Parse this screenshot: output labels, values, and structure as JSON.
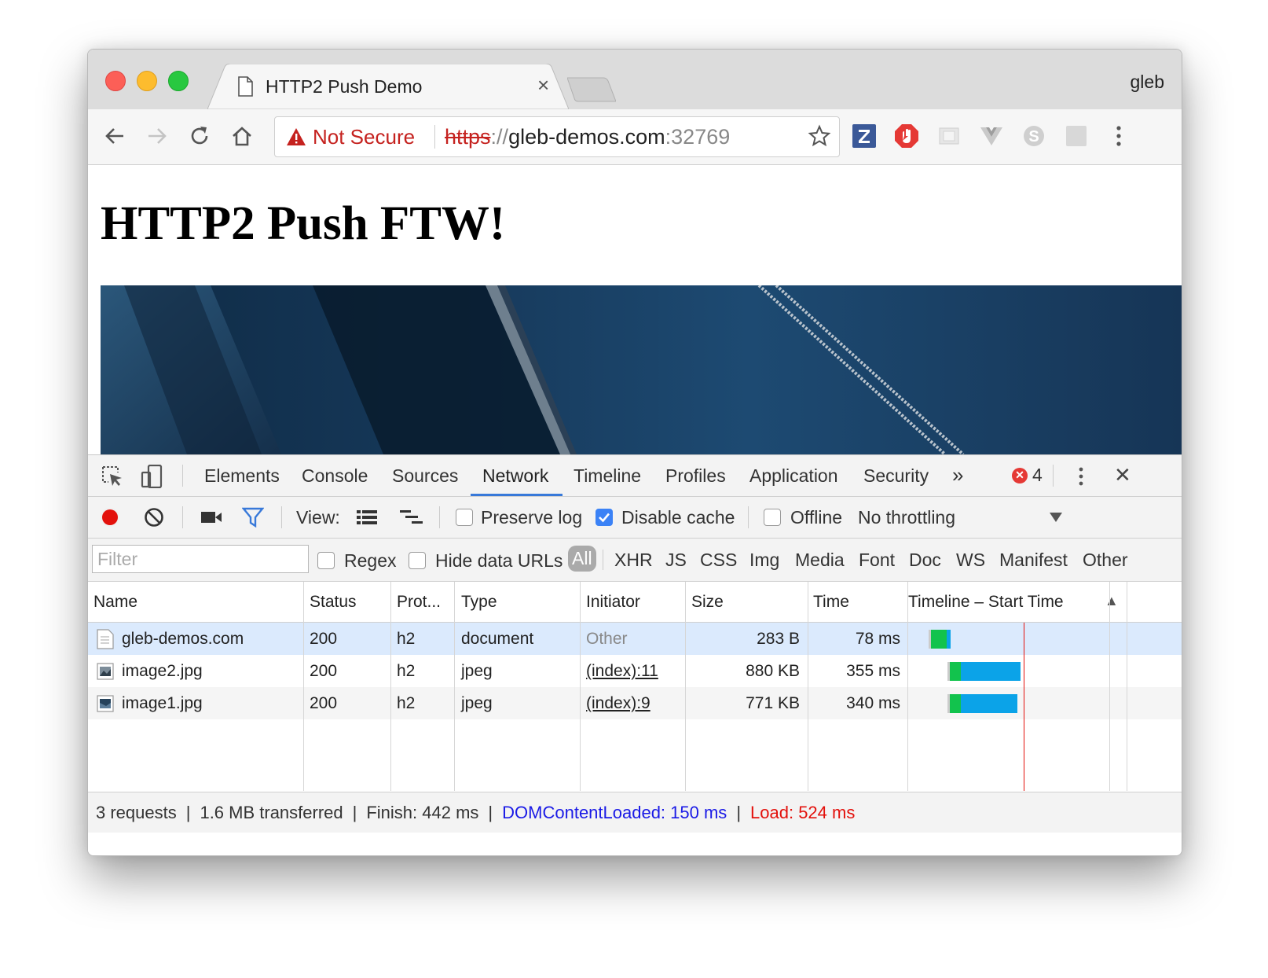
{
  "window": {
    "tab_title": "HTTP2 Push Demo",
    "tab_close": "×",
    "profile_name": "gleb"
  },
  "omnibox": {
    "security_label": "Not Secure",
    "url_scheme": "https",
    "url_sep": "://",
    "url_host": "gleb-demos.com",
    "url_port": ":32769"
  },
  "extensions": [
    "zotero-icon",
    "adblock-icon",
    "pdf-icon",
    "vue-devtools-icon",
    "skype-icon",
    "extension-icon"
  ],
  "page": {
    "heading": "HTTP2 Push FTW!"
  },
  "devtools": {
    "tabs": [
      "Elements",
      "Console",
      "Sources",
      "Network",
      "Timeline",
      "Profiles",
      "Application",
      "Security"
    ],
    "active_tab": "Network",
    "more_tabs": "»",
    "error_count": "4",
    "error_mark": "✕",
    "close": "✕",
    "toolbar": {
      "view_label": "View:",
      "preserve_log": "Preserve log",
      "preserve_log_checked": false,
      "disable_cache": "Disable cache",
      "disable_cache_checked": true,
      "offline": "Offline",
      "offline_checked": false,
      "throttling": "No throttling"
    },
    "filter": {
      "placeholder": "Filter",
      "regex": "Regex",
      "hide_data_urls": "Hide data URLs",
      "types": [
        "All",
        "XHR",
        "JS",
        "CSS",
        "Img",
        "Media",
        "Font",
        "Doc",
        "WS",
        "Manifest",
        "Other"
      ],
      "active_type": "All"
    },
    "columns": [
      "Name",
      "Status",
      "Prot...",
      "Type",
      "Initiator",
      "Size",
      "Time",
      "Timeline – Start Time"
    ],
    "sort_indicator": "▲",
    "requests": [
      {
        "name": "gleb-demos.com",
        "status": "200",
        "protocol": "h2",
        "type": "document",
        "initiator": "Other",
        "size": "283 B",
        "time": "78 ms",
        "icon": "document-icon"
      },
      {
        "name": "image2.jpg",
        "status": "200",
        "protocol": "h2",
        "type": "jpeg",
        "initiator": "(index):11",
        "size": "880 KB",
        "time": "355 ms",
        "icon": "image-icon"
      },
      {
        "name": "image1.jpg",
        "status": "200",
        "protocol": "h2",
        "type": "jpeg",
        "initiator": "(index):9",
        "size": "771 KB",
        "time": "340 ms",
        "icon": "image-icon"
      }
    ],
    "status_bar": {
      "requests": "3 requests",
      "transferred": "1.6 MB transferred",
      "finish": "Finish: 442 ms",
      "dom_content_loaded": "DOMContentLoaded: 150 ms",
      "load": "Load: 524 ms",
      "separator": "|"
    }
  },
  "colors": {
    "waiting": "#12c34d",
    "download": "#0ba3e8",
    "load_line": "#e3110c",
    "dcl": "#1a1ae6",
    "accent": "#3879d9"
  }
}
